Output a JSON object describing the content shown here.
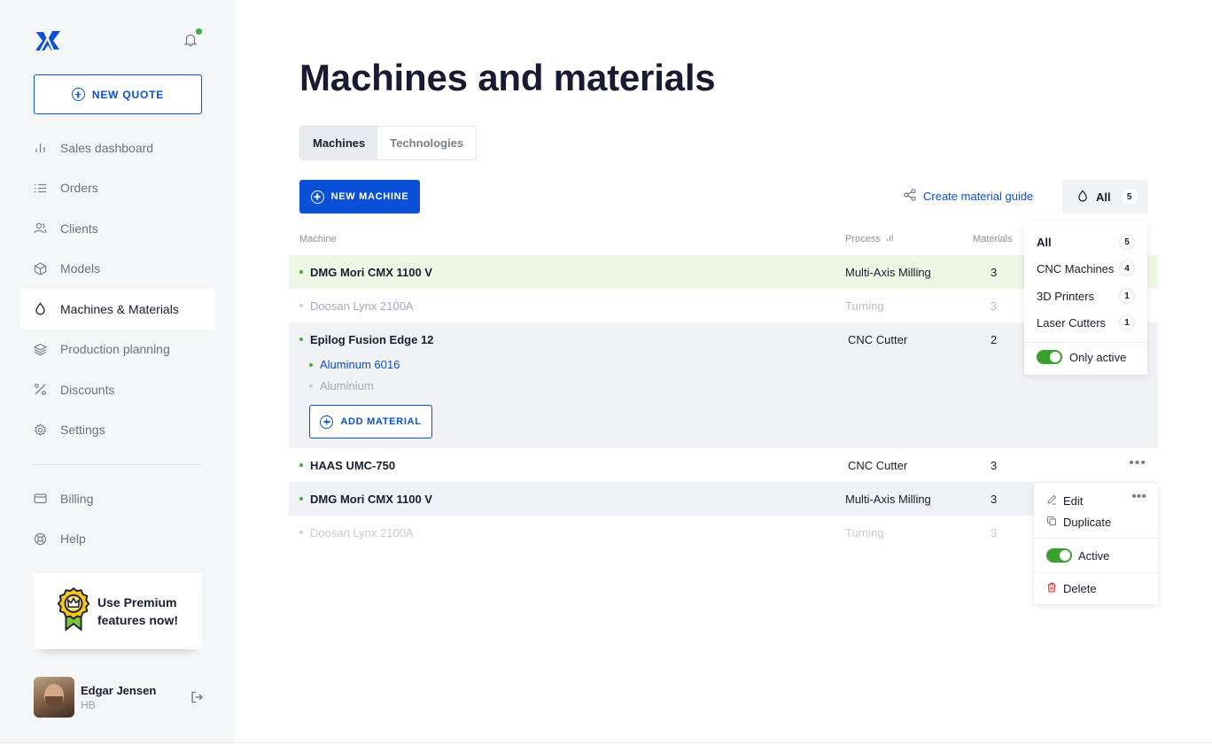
{
  "sidebar": {
    "new_quote_label": "NEW QUOTE",
    "items": [
      {
        "label": "Sales dashboard",
        "icon": "bar-chart-icon"
      },
      {
        "label": "Orders",
        "icon": "list-icon"
      },
      {
        "label": "Clients",
        "icon": "users-icon"
      },
      {
        "label": "Models",
        "icon": "cube-icon"
      },
      {
        "label": "Machines & Materials",
        "icon": "drop-icon",
        "active": true
      },
      {
        "label": "Production planning",
        "icon": "layers-icon"
      },
      {
        "label": "Discounts",
        "icon": "percent-icon"
      },
      {
        "label": "Settings",
        "icon": "gear-icon"
      }
    ],
    "secondary": [
      {
        "label": "Billing",
        "icon": "card-icon"
      },
      {
        "label": "Help",
        "icon": "lifebuoy-icon"
      }
    ],
    "premium": {
      "line1": "Use Premium",
      "line2": "features now!"
    },
    "user": {
      "name": "Edgar Jensen",
      "org": "HB"
    }
  },
  "main": {
    "title": "Machines and materials",
    "tabs": [
      {
        "label": "Machines",
        "active": true
      },
      {
        "label": "Technologies",
        "active": false
      }
    ],
    "new_machine_label": "NEW MACHINE",
    "material_guide_label": "Create material guide",
    "filter": {
      "label": "All",
      "count": "5"
    },
    "columns": {
      "machine": "Machine",
      "process": "Process",
      "materials": "Materials"
    },
    "rows": [
      {
        "name": "DMG Mori CMX 1100 V",
        "process": "Multi-Axis Milling",
        "materials": "3",
        "active": true
      },
      {
        "name": "Doosan Lynx 2100A",
        "process": "Turning",
        "materials": "3",
        "active": false
      },
      {
        "name": "Epilog Fusion Edge 12",
        "process": "CNC Cutter",
        "materials": "2",
        "active": true
      },
      {
        "name": "HAAS UMC-750",
        "process": "CNC Cutter",
        "materials": "3",
        "active": true
      },
      {
        "name": "DMG Mori CMX 1100 V",
        "process": "Multi-Axis Milling",
        "materials": "3",
        "active": true
      },
      {
        "name": "Doosan Lynx 2100A",
        "process": "Turning",
        "materials": "3",
        "active": false
      }
    ],
    "expanded_materials": [
      {
        "name": "Aluminum 6016",
        "active": true
      },
      {
        "name": "Aluminium",
        "active": false
      }
    ],
    "add_material_label": "ADD MATERIAL"
  },
  "filter_menu": {
    "items": [
      {
        "label": "All",
        "count": "5"
      },
      {
        "label": "CNC Machines",
        "count": "4"
      },
      {
        "label": "3D Printers",
        "count": "1"
      },
      {
        "label": "Laser Cutters",
        "count": "1"
      }
    ],
    "only_active_label": "Only active"
  },
  "row_menu": {
    "edit": "Edit",
    "duplicate": "Duplicate",
    "active": "Active",
    "delete": "Delete"
  },
  "colors": {
    "accent": "#0a4fd8",
    "success": "#2fb53a",
    "toggle": "#3aa12f",
    "highlight_row": "#eef6e6",
    "danger": "#d42a2a"
  }
}
